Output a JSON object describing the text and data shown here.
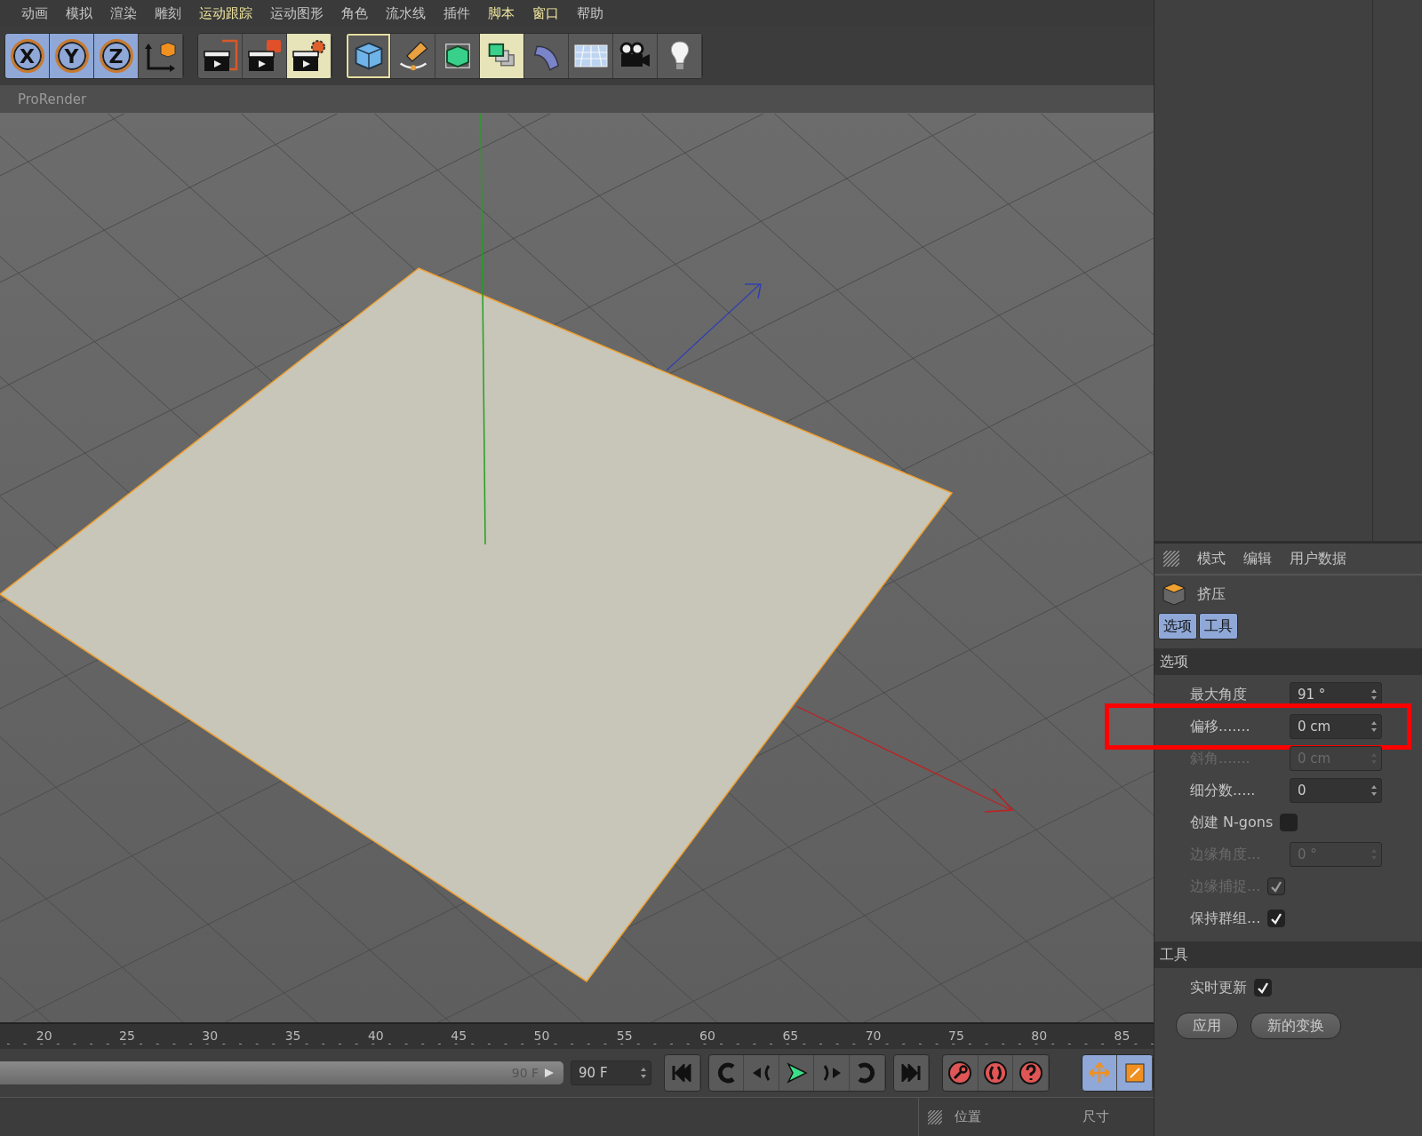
{
  "menu": [
    {
      "label": "动画",
      "highlighted": false
    },
    {
      "label": "模拟",
      "highlighted": false
    },
    {
      "label": "渲染",
      "highlighted": false
    },
    {
      "label": "雕刻",
      "highlighted": false
    },
    {
      "label": "运动跟踪",
      "highlighted": true
    },
    {
      "label": "运动图形",
      "highlighted": false
    },
    {
      "label": "角色",
      "highlighted": false
    },
    {
      "label": "流水线",
      "highlighted": false
    },
    {
      "label": "插件",
      "highlighted": false
    },
    {
      "label": "脚本",
      "highlighted": true
    },
    {
      "label": "窗口",
      "highlighted": true
    },
    {
      "label": "帮助",
      "highlighted": false
    }
  ],
  "toolbar": {
    "axis_buttons": [
      {
        "label": "X",
        "selected": true
      },
      {
        "label": "Y",
        "selected": true
      },
      {
        "label": "Z",
        "selected": true
      }
    ]
  },
  "viewport": {
    "renderer": "ProRender"
  },
  "timeline": {
    "ticks": [
      "20",
      "25",
      "30",
      "35",
      "40",
      "45",
      "50",
      "55",
      "60",
      "65",
      "70",
      "75",
      "80",
      "85"
    ],
    "range": {
      "level": 1,
      "end": "90 F"
    },
    "end_field": "90 F"
  },
  "coordinates": {
    "columns": [
      "位置",
      "尺寸"
    ]
  },
  "attributes": {
    "menu": [
      "模式",
      "编辑",
      "用户数据"
    ],
    "object": "挤压",
    "tabs": [
      {
        "label": "选项",
        "selected": true
      },
      {
        "label": "工具",
        "selected": true
      }
    ],
    "sections": [
      {
        "title": "选项",
        "rows": [
          {
            "kind": "number",
            "label": "最大角度",
            "value": "91 °",
            "disabled": false,
            "highlighted": false
          },
          {
            "kind": "number",
            "label": "偏移.......",
            "value": "0 cm",
            "disabled": false,
            "highlighted": true
          },
          {
            "kind": "number",
            "label": "斜角.......",
            "value": "0 cm",
            "disabled": true,
            "highlighted": false
          },
          {
            "kind": "number",
            "label": "细分数.....",
            "value": "0",
            "disabled": false,
            "highlighted": false
          },
          {
            "kind": "checkbox",
            "label": "创建 N-gons",
            "checked": false,
            "disabled": false,
            "highlighted": false
          },
          {
            "kind": "number",
            "label": "边缘角度...",
            "value": "0 °",
            "disabled": true,
            "highlighted": false
          },
          {
            "kind": "checkbox",
            "label": "边缘捕捉...",
            "checked": true,
            "disabled": true,
            "highlighted": false
          },
          {
            "kind": "checkbox",
            "label": "保持群组...",
            "checked": true,
            "disabled": false,
            "highlighted": false
          }
        ]
      },
      {
        "title": "工具",
        "rows": [
          {
            "kind": "checkbox",
            "label": "实时更新",
            "checked": true,
            "disabled": false,
            "highlighted": false
          }
        ],
        "buttons": [
          "应用",
          "新的变换"
        ]
      }
    ]
  }
}
